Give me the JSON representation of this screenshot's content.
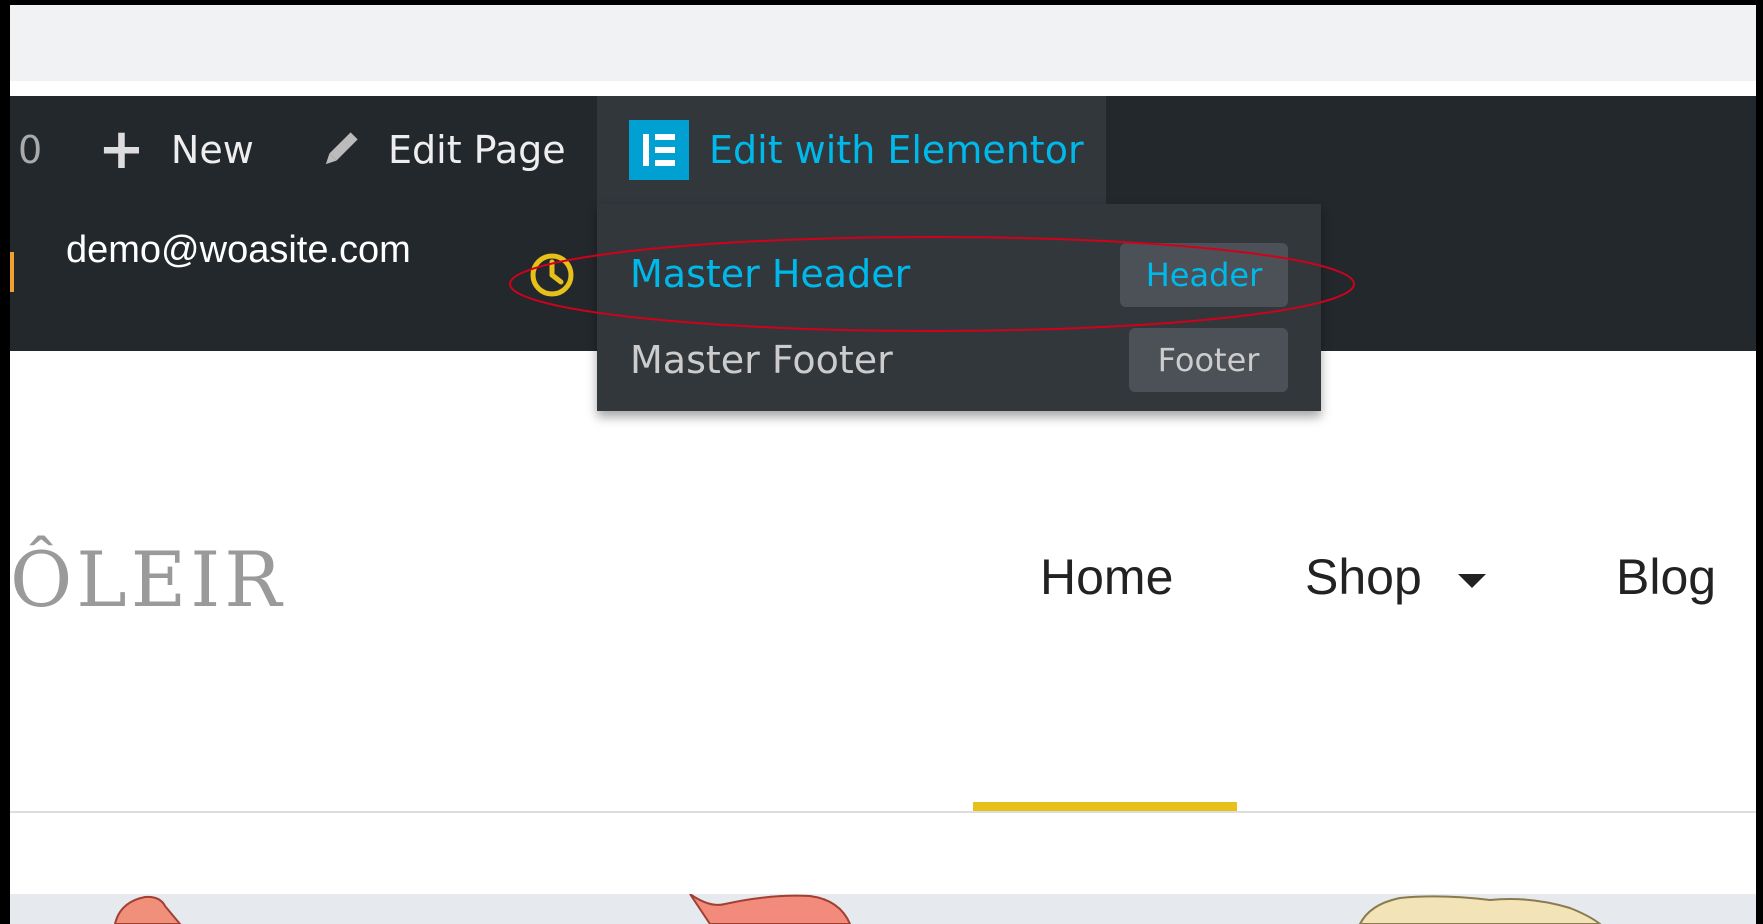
{
  "admin_bar": {
    "comments_count": "0",
    "new_label": "New",
    "edit_page_label": "Edit Page",
    "elementor_label": "Edit with Elementor",
    "user_email": "demo@woasite.com"
  },
  "elementor_menu": {
    "items": [
      {
        "label": "Master Header",
        "badge": "Header"
      },
      {
        "label": "Master Footer",
        "badge": "Footer"
      }
    ]
  },
  "site": {
    "logo_text": "ÔLEIR",
    "nav": [
      {
        "label": "Home"
      },
      {
        "label": "Shop"
      },
      {
        "label": "Blog"
      }
    ]
  },
  "colors": {
    "admin_bar_bg": "#23282d",
    "elementor_accent": "#00b9eb",
    "nav_active_underline": "#e8c01a",
    "annotation": "#d0021b"
  }
}
